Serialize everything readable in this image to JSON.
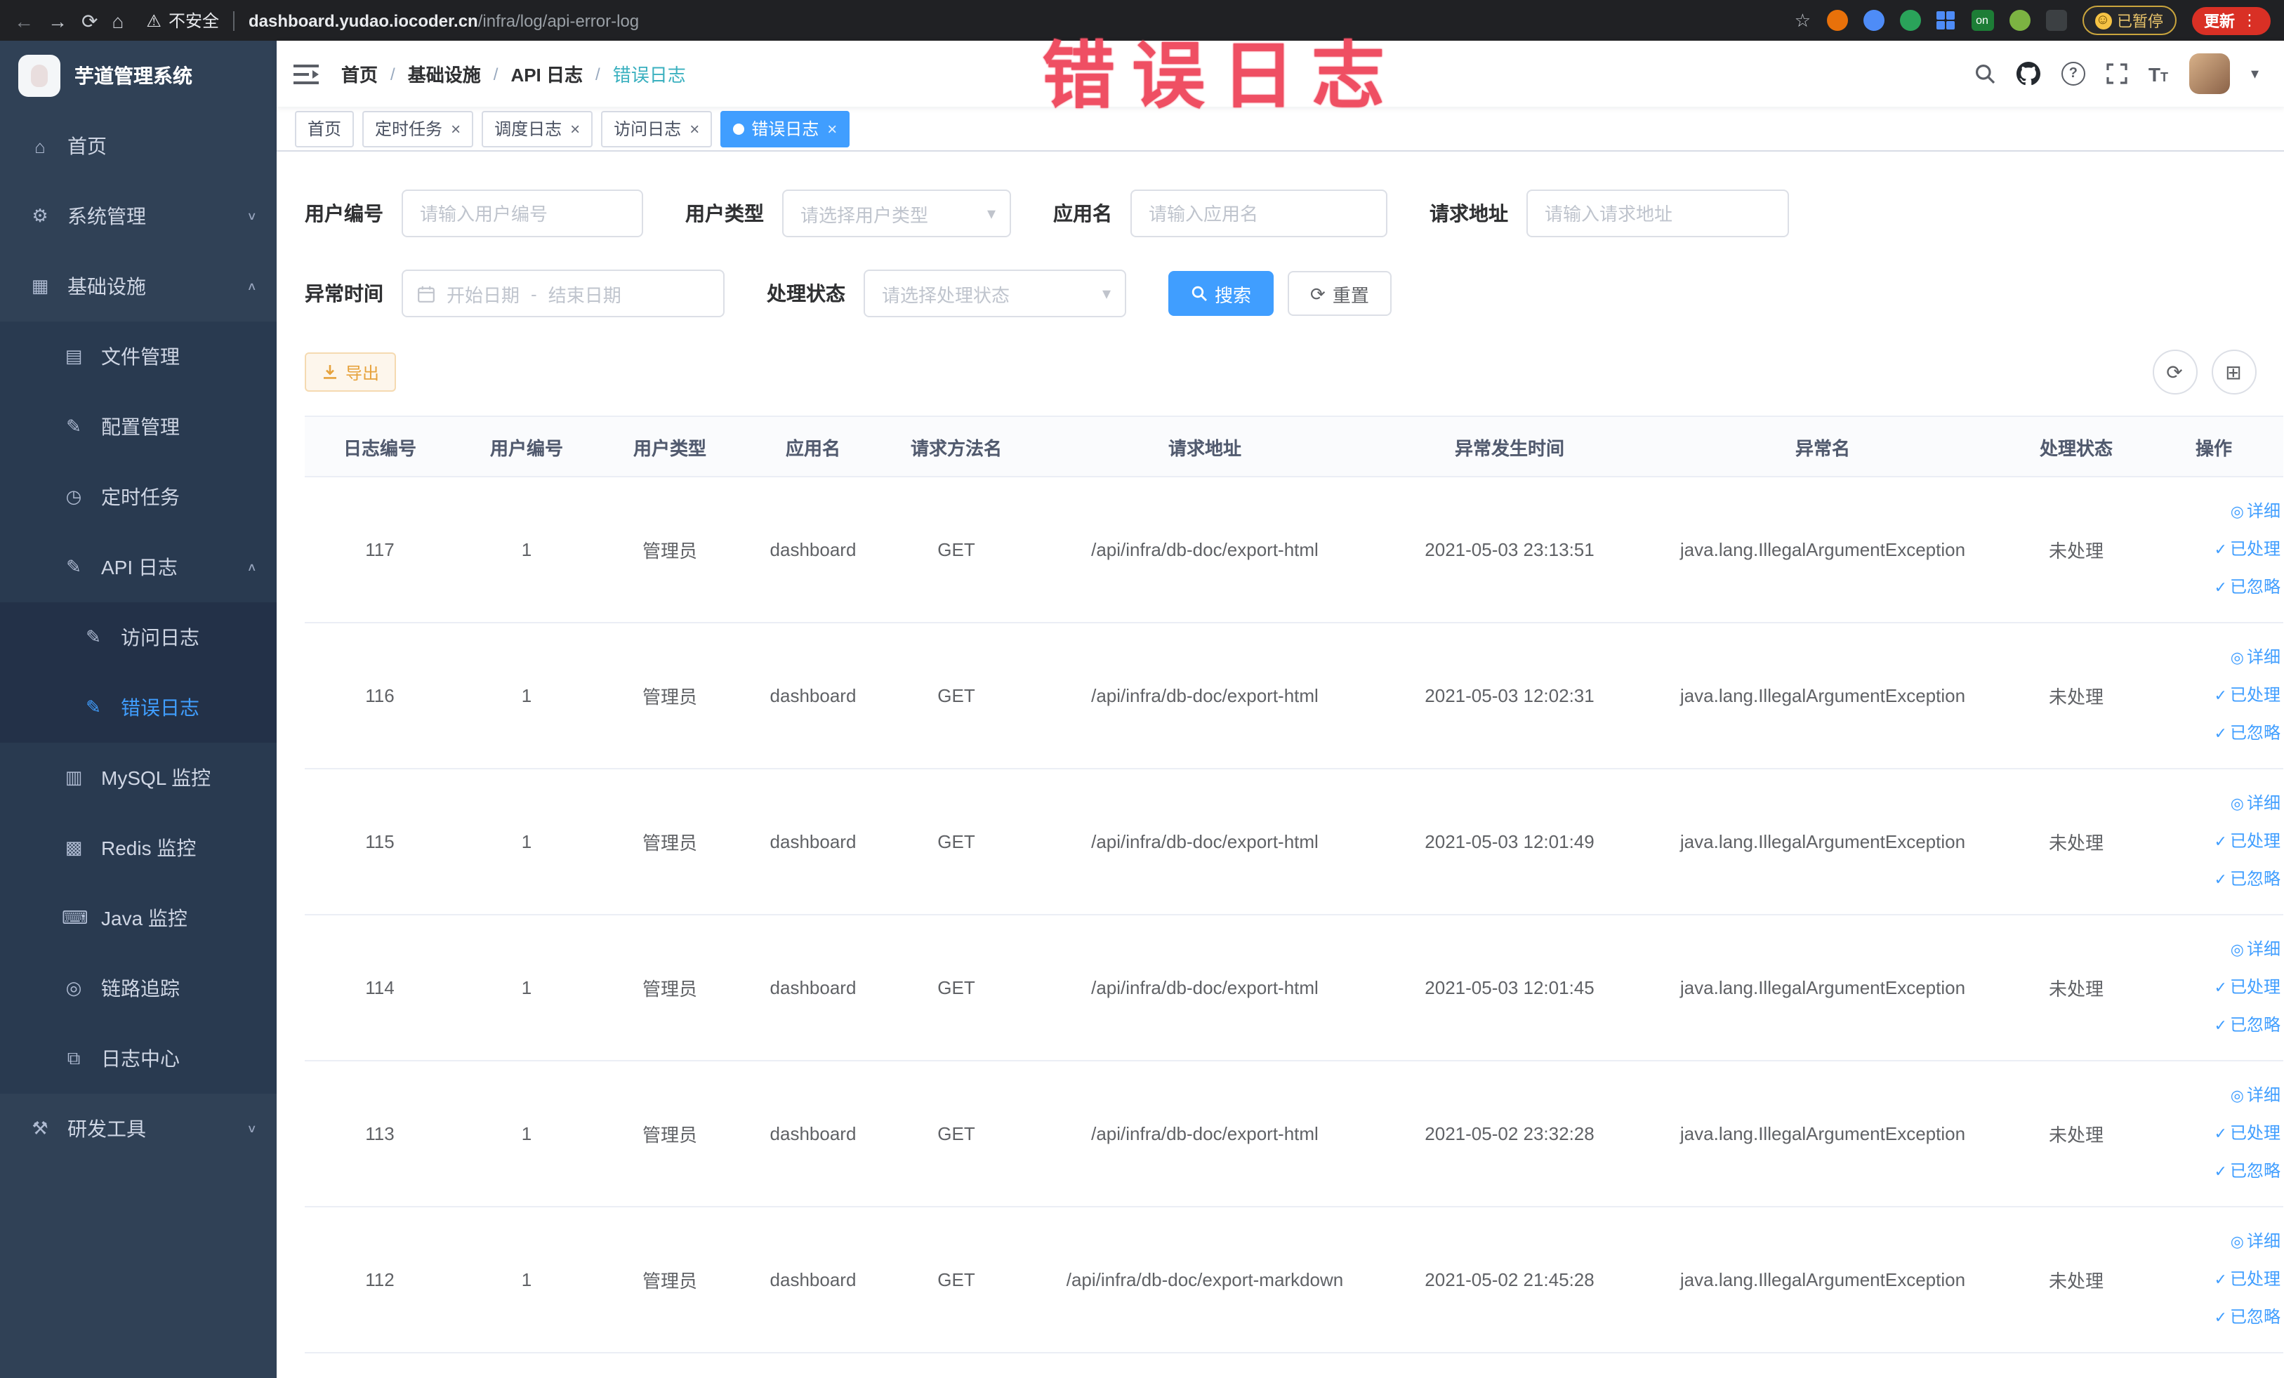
{
  "browser": {
    "security_label": "不安全",
    "url_host": "dashboard.yudao.iocoder.cn",
    "url_path": "/infra/log/api-error-log",
    "extension_badge": "on",
    "paused_label": "已暂停",
    "update_label": "更新"
  },
  "annotation": {
    "text": "错误日志",
    "color": "#ef4f63"
  },
  "sidebar": {
    "logo_title": "芋道管理系统",
    "items": [
      {
        "key": "home",
        "label": "首页",
        "icon": "home-icon",
        "level": 1
      },
      {
        "key": "system",
        "label": "系统管理",
        "icon": "gear-icon",
        "level": 1,
        "chevron": "down"
      },
      {
        "key": "infra",
        "label": "基础设施",
        "icon": "infra-icon",
        "level": 1,
        "chevron": "up"
      },
      {
        "key": "file",
        "label": "文件管理",
        "icon": "file-icon",
        "level": 2
      },
      {
        "key": "config",
        "label": "配置管理",
        "icon": "config-icon",
        "level": 2
      },
      {
        "key": "job",
        "label": "定时任务",
        "icon": "timer-icon",
        "level": 2
      },
      {
        "key": "api-log",
        "label": "API 日志",
        "icon": "api-log-icon",
        "level": 2,
        "chevron": "up"
      },
      {
        "key": "access-log",
        "label": "访问日志",
        "icon": "access-log-icon",
        "level": 3
      },
      {
        "key": "error-log",
        "label": "错误日志",
        "icon": "error-log-icon",
        "level": 3,
        "active": true
      },
      {
        "key": "mysql",
        "label": "MySQL 监控",
        "icon": "mysql-icon",
        "level": 2
      },
      {
        "key": "redis",
        "label": "Redis 监控",
        "icon": "redis-icon",
        "level": 2
      },
      {
        "key": "java",
        "label": "Java 监控",
        "icon": "java-icon",
        "level": 2
      },
      {
        "key": "trace",
        "label": "链路追踪",
        "icon": "trace-icon",
        "level": 2
      },
      {
        "key": "log-center",
        "label": "日志中心",
        "icon": "log-center-icon",
        "level": 2
      },
      {
        "key": "dev-tools",
        "label": "研发工具",
        "icon": "tools-icon",
        "level": 1,
        "chevron": "down"
      }
    ]
  },
  "icon_glyphs": {
    "home-icon": "⌂",
    "gear-icon": "⚙",
    "infra-icon": "▦",
    "file-icon": "▤",
    "config-icon": "✎",
    "timer-icon": "◷",
    "api-log-icon": "✎",
    "access-log-icon": "✎",
    "error-log-icon": "✎",
    "mysql-icon": "▥",
    "redis-icon": "▩",
    "java-icon": "⌨",
    "trace-icon": "◎",
    "log-center-icon": "⧉",
    "tools-icon": "⚒"
  },
  "breadcrumb": [
    "首页",
    "基础设施",
    "API 日志",
    "错误日志"
  ],
  "tabs": [
    {
      "key": "home",
      "label": "首页",
      "closable": false,
      "active": false
    },
    {
      "key": "job",
      "label": "定时任务",
      "closable": true,
      "active": false
    },
    {
      "key": "job-log",
      "label": "调度日志",
      "closable": true,
      "active": false
    },
    {
      "key": "access-log",
      "label": "访问日志",
      "closable": true,
      "active": false
    },
    {
      "key": "error-log",
      "label": "错误日志",
      "closable": true,
      "active": true
    }
  ],
  "filters": {
    "user_id_label": "用户编号",
    "user_id_placeholder": "请输入用户编号",
    "user_type_label": "用户类型",
    "user_type_placeholder": "请选择用户类型",
    "app_name_label": "应用名",
    "app_name_placeholder": "请输入应用名",
    "request_url_label": "请求地址",
    "request_url_placeholder": "请输入请求地址",
    "exception_time_label": "异常时间",
    "date_start_placeholder": "开始日期",
    "date_separator": "-",
    "date_end_placeholder": "结束日期",
    "process_status_label": "处理状态",
    "process_status_placeholder": "请选择处理状态",
    "search_label": "搜索",
    "reset_label": "重置"
  },
  "toolbar": {
    "export_label": "导出"
  },
  "table": {
    "columns": [
      "日志编号",
      "用户编号",
      "用户类型",
      "应用名",
      "请求方法名",
      "请求地址",
      "异常发生时间",
      "异常名",
      "处理状态",
      "操作"
    ],
    "row_keys": [
      "id",
      "user_id",
      "user_type",
      "app_name",
      "method",
      "request_url",
      "time",
      "exception",
      "status"
    ],
    "actions": {
      "detail": "详细",
      "processed": "已处理",
      "ignored": "已忽略"
    },
    "rows": [
      {
        "id": "117",
        "user_id": "1",
        "user_type": "管理员",
        "app_name": "dashboard",
        "method": "GET",
        "request_url": "/api/infra/db-doc/export-html",
        "time": "2021-05-03 23:13:51",
        "exception": "java.lang.IllegalArgumentException",
        "status": "未处理"
      },
      {
        "id": "116",
        "user_id": "1",
        "user_type": "管理员",
        "app_name": "dashboard",
        "method": "GET",
        "request_url": "/api/infra/db-doc/export-html",
        "time": "2021-05-03 12:02:31",
        "exception": "java.lang.IllegalArgumentException",
        "status": "未处理"
      },
      {
        "id": "115",
        "user_id": "1",
        "user_type": "管理员",
        "app_name": "dashboard",
        "method": "GET",
        "request_url": "/api/infra/db-doc/export-html",
        "time": "2021-05-03 12:01:49",
        "exception": "java.lang.IllegalArgumentException",
        "status": "未处理"
      },
      {
        "id": "114",
        "user_id": "1",
        "user_type": "管理员",
        "app_name": "dashboard",
        "method": "GET",
        "request_url": "/api/infra/db-doc/export-html",
        "time": "2021-05-03 12:01:45",
        "exception": "java.lang.IllegalArgumentException",
        "status": "未处理"
      },
      {
        "id": "113",
        "user_id": "1",
        "user_type": "管理员",
        "app_name": "dashboard",
        "method": "GET",
        "request_url": "/api/infra/db-doc/export-html",
        "time": "2021-05-02 23:32:28",
        "exception": "java.lang.IllegalArgumentException",
        "status": "未处理"
      },
      {
        "id": "112",
        "user_id": "1",
        "user_type": "管理员",
        "app_name": "dashboard",
        "method": "GET",
        "request_url": "/api/infra/db-doc/export-markdown",
        "time": "2021-05-02 21:45:28",
        "exception": "java.lang.IllegalArgumentException",
        "status": "未处理"
      }
    ]
  }
}
